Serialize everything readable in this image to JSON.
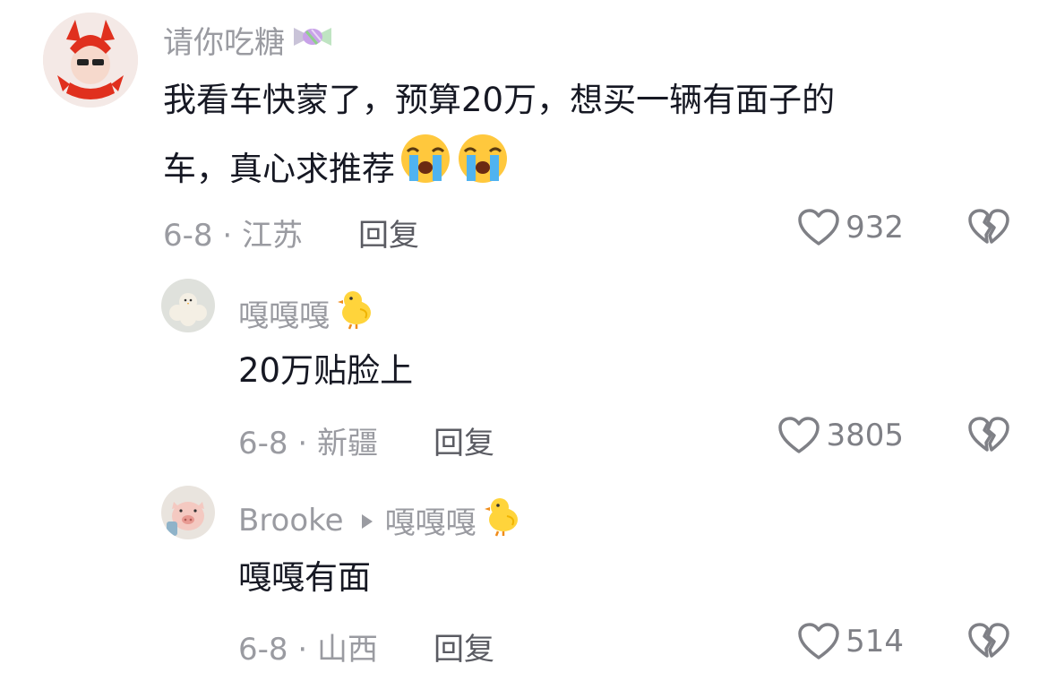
{
  "comments": [
    {
      "username": "请你吃糖",
      "name_emoji": "candy-icon",
      "text_line1": "我看车快蒙了，预算20万，想买一辆有面子的",
      "text_line2": "车，真心求推荐",
      "text_emojis": [
        "loudly-crying-face-icon",
        "loudly-crying-face-icon"
      ],
      "date_location": "6-8 · 江苏",
      "reply_label": "回复",
      "like_count": "932"
    },
    {
      "username": "嘎嘎嘎",
      "name_emoji": "baby-chick-icon",
      "text": "20万贴脸上",
      "date_location": "6-8 · 新疆",
      "reply_label": "回复",
      "like_count": "3805"
    },
    {
      "username": "Brooke",
      "reply_to": "嘎嘎嘎",
      "name_emoji": "baby-chick-icon",
      "text": "嘎嘎有面",
      "date_location": "6-8 · 山西",
      "reply_label": "回复",
      "like_count": "514"
    }
  ],
  "colors": {
    "meta_gray": "#9a9ba1",
    "text_dark": "#161823",
    "reply_gray": "#5a5b62"
  }
}
